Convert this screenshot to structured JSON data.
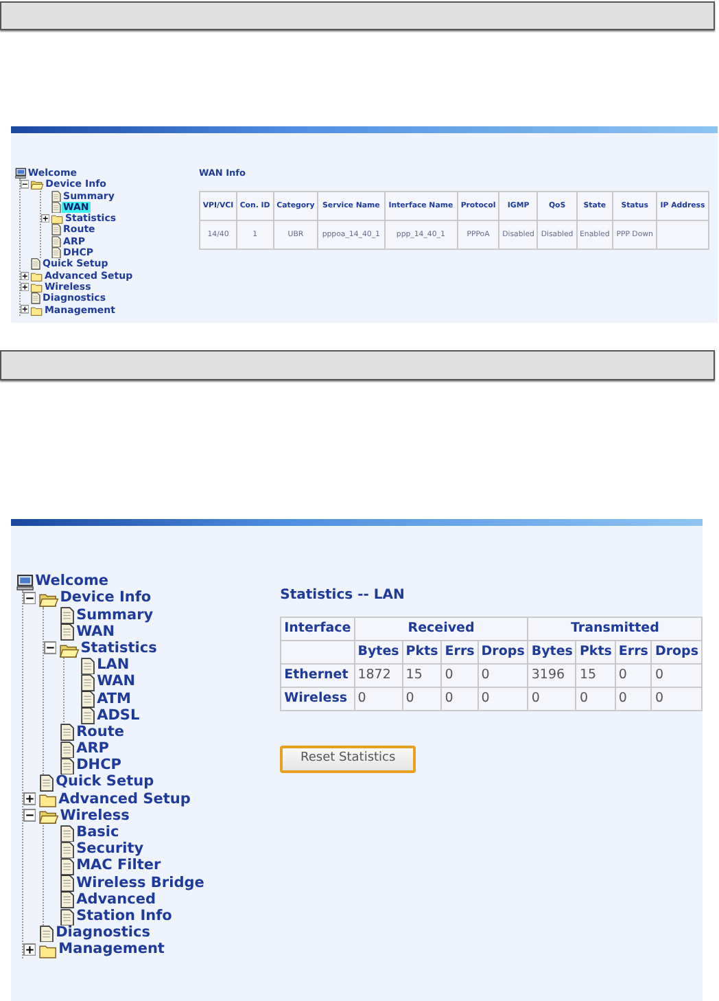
{
  "panels": [
    {
      "tree": [
        {
          "label": "Welcome",
          "kind": "root",
          "selected": false,
          "children": [
            {
              "label": "Device Info",
              "kind": "folder",
              "expanded": true,
              "selected": false,
              "children": [
                {
                  "label": "Summary",
                  "kind": "page",
                  "selected": false
                },
                {
                  "label": "WAN",
                  "kind": "page",
                  "selected": true
                },
                {
                  "label": "Statistics",
                  "kind": "folder",
                  "expanded": false,
                  "selected": false
                },
                {
                  "label": "Route",
                  "kind": "page",
                  "selected": false
                },
                {
                  "label": "ARP",
                  "kind": "page",
                  "selected": false
                },
                {
                  "label": "DHCP",
                  "kind": "page",
                  "selected": false
                }
              ]
            },
            {
              "label": "Quick Setup",
              "kind": "page",
              "selected": false
            },
            {
              "label": "Advanced Setup",
              "kind": "folder",
              "expanded": false,
              "selected": false
            },
            {
              "label": "Wireless",
              "kind": "folder",
              "expanded": false,
              "selected": false
            },
            {
              "label": "Diagnostics",
              "kind": "page",
              "selected": false
            },
            {
              "label": "Management",
              "kind": "folder",
              "expanded": false,
              "selected": false
            }
          ]
        }
      ],
      "content": {
        "title": "WAN Info",
        "table": {
          "kind": "flat",
          "columns": [
            "VPI/VCI",
            "Con. ID",
            "Category",
            "Service Name",
            "Interface Name",
            "Protocol",
            "IGMP",
            "QoS",
            "State",
            "Status",
            "IP Address"
          ],
          "rows": [
            [
              "14/40",
              "1",
              "UBR",
              "pppoa_14_40_1",
              "ppp_14_40_1",
              "PPPoA",
              "Disabled",
              "Disabled",
              "Enabled",
              "PPP Down"
            ]
          ]
        }
      }
    },
    {
      "tree": [
        {
          "label": "Welcome",
          "kind": "root",
          "selected": false,
          "children": [
            {
              "label": "Device Info",
              "kind": "folder",
              "expanded": true,
              "selected": false,
              "children": [
                {
                  "label": "Summary",
                  "kind": "page",
                  "selected": false
                },
                {
                  "label": "WAN",
                  "kind": "page",
                  "selected": false
                },
                {
                  "label": "Statistics",
                  "kind": "folder",
                  "expanded": true,
                  "selected": false,
                  "children": [
                    {
                      "label": "LAN",
                      "kind": "page",
                      "selected": false
                    },
                    {
                      "label": "WAN",
                      "kind": "page",
                      "selected": false
                    },
                    {
                      "label": "ATM",
                      "kind": "page",
                      "selected": false
                    },
                    {
                      "label": "ADSL",
                      "kind": "page",
                      "selected": false
                    }
                  ]
                },
                {
                  "label": "Route",
                  "kind": "page",
                  "selected": false
                },
                {
                  "label": "ARP",
                  "kind": "page",
                  "selected": false
                },
                {
                  "label": "DHCP",
                  "kind": "page",
                  "selected": false
                }
              ]
            },
            {
              "label": "Quick Setup",
              "kind": "page",
              "selected": false
            },
            {
              "label": "Advanced Setup",
              "kind": "folder",
              "expanded": false,
              "selected": false
            },
            {
              "label": "Wireless",
              "kind": "folder",
              "expanded": true,
              "selected": false,
              "children": [
                {
                  "label": "Basic",
                  "kind": "page",
                  "selected": false
                },
                {
                  "label": "Security",
                  "kind": "page",
                  "selected": false
                },
                {
                  "label": "MAC Filter",
                  "kind": "page",
                  "selected": false
                },
                {
                  "label": "Wireless Bridge",
                  "kind": "page",
                  "selected": false
                },
                {
                  "label": "Advanced",
                  "kind": "page",
                  "selected": false
                },
                {
                  "label": "Station Info",
                  "kind": "page",
                  "selected": false
                }
              ]
            },
            {
              "label": "Diagnostics",
              "kind": "page",
              "selected": false
            },
            {
              "label": "Management",
              "kind": "folder",
              "expanded": false,
              "selected": false
            }
          ]
        }
      ],
      "content": {
        "title": "Statistics -- LAN",
        "table": {
          "kind": "grouped",
          "row_header": "Interface",
          "groups": [
            {
              "label": "Received",
              "columns": [
                "Bytes",
                "Pkts",
                "Errs",
                "Drops"
              ]
            },
            {
              "label": "Transmitted",
              "columns": [
                "Bytes",
                "Pkts",
                "Errs",
                "Drops"
              ]
            }
          ],
          "rows": [
            {
              "label": "Ethernet",
              "values": [
                "1872",
                "15",
                "0",
                "0",
                "3196",
                "15",
                "0",
                "0"
              ]
            },
            {
              "label": "Wireless",
              "values": [
                "0",
                "0",
                "0",
                "0",
                "0",
                "0",
                "0",
                "0"
              ]
            }
          ]
        },
        "button": "Reset Statistics"
      }
    }
  ]
}
